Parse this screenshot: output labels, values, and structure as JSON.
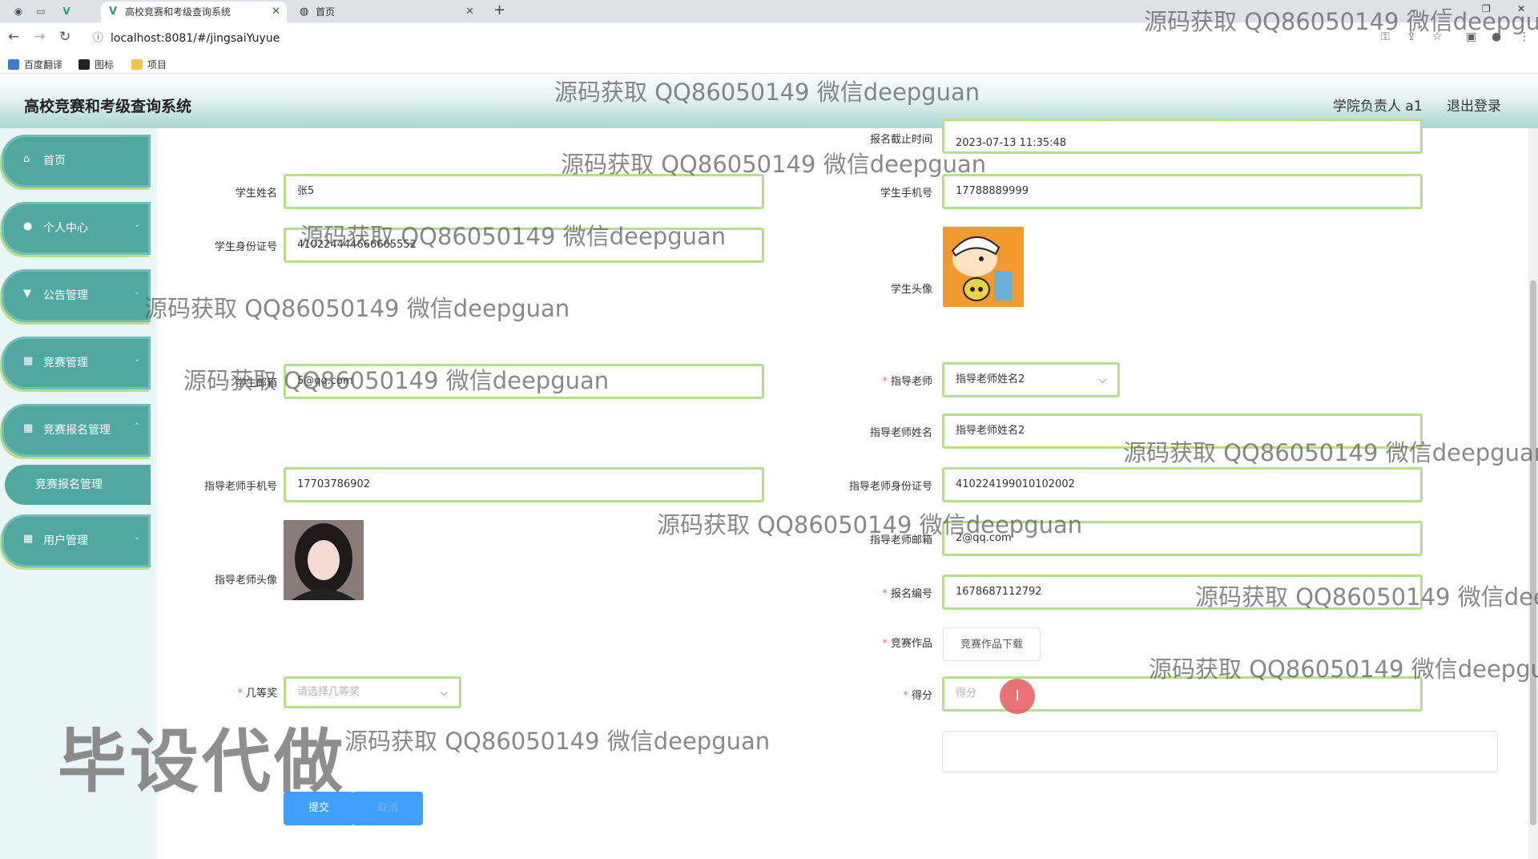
{
  "browser": {
    "tabs": [
      {
        "title": "高校竞赛和考级查询系统",
        "active": true
      },
      {
        "title": "首页",
        "active": false
      }
    ],
    "url": "localhost:8081/#/jingsaiYuyue",
    "bookmarks": [
      "百度翻译",
      "图标",
      "项目"
    ]
  },
  "header": {
    "title": "高校竞赛和考级查询系统",
    "user": "学院负责人 a1",
    "logout": "退出登录"
  },
  "sidebar": {
    "items": [
      {
        "label": "首页",
        "icon": "home-icon"
      },
      {
        "label": "个人中心",
        "icon": "user-icon"
      },
      {
        "label": "公告管理",
        "icon": "notice-icon"
      },
      {
        "label": "竞赛管理",
        "icon": "grid-icon"
      },
      {
        "label": "竞赛报名管理",
        "icon": "grid-icon"
      },
      {
        "label": "用户管理",
        "icon": "grid-icon"
      }
    ],
    "subitem": "竞赛报名管理"
  },
  "form": {
    "deadline_label": "报名截止时间",
    "deadline_value": "2023-07-13 11:35:48",
    "student_name_label": "学生姓名",
    "student_name_value": "张5",
    "student_phone_label": "学生手机号",
    "student_phone_value": "17788889999",
    "student_id_label": "学生身份证号",
    "student_id_value": "410224444666665552",
    "student_avatar_label": "学生头像",
    "student_email_label": "学生邮箱",
    "student_email_value": "5@qq.com",
    "teacher_label": "指导老师",
    "teacher_value": "指导老师姓名2",
    "teacher_name_label": "指导老师姓名",
    "teacher_name_value": "指导老师姓名2",
    "teacher_phone_label": "指导老师手机号",
    "teacher_phone_value": "17703786902",
    "teacher_id_label": "指导老师身份证号",
    "teacher_id_value": "410224199010102002",
    "teacher_avatar_label": "指导老师头像",
    "teacher_email_label": "指导老师邮箱",
    "teacher_email_value": "2@qq.com",
    "reg_no_label": "报名编号",
    "reg_no_value": "1678687112792",
    "work_label": "竞赛作品",
    "work_button": "竞赛作品下载",
    "award_label": "几等奖",
    "award_placeholder": "请选择几等奖",
    "score_label": "得分",
    "score_placeholder": "得分",
    "submit": "提交",
    "cancel": "取消"
  },
  "watermarks": {
    "text": "源码获取 QQ86050149 微信deepguan",
    "big": "毕设代做"
  },
  "colors": {
    "accent": "#51a8a1",
    "input_border": "#b7dd8e",
    "primary": "#409eff",
    "required": "#f56c6c"
  }
}
